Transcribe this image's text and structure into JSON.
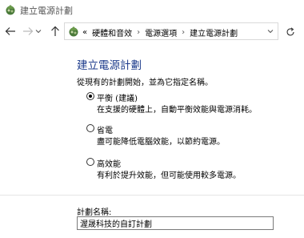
{
  "window": {
    "title": "建立電源計劃"
  },
  "nav": {
    "back_icon": "arrow-left-icon",
    "forward_icon": "arrow-right-icon",
    "up_icon": "arrow-up-icon",
    "breadcrumb_lead": "«",
    "breadcrumbs": [
      "硬體和音效",
      "電源選項",
      "建立電源計劃"
    ],
    "dropdown_icon": "chevron-down-icon",
    "refresh_icon": "refresh-icon"
  },
  "main": {
    "heading": "建立電源計劃",
    "intro": "從現有的計劃開始，並為它指定名稱。",
    "options": [
      {
        "label": "平衡 (建議)",
        "description": "在支援的硬體上，自動平衡效能與電源消耗。",
        "selected": true
      },
      {
        "label": "省電",
        "description": "盡可能降低電腦效能，以節約電源。",
        "selected": false
      },
      {
        "label": "高效能",
        "description": "有利於提升效能，但可能使用較多電源。",
        "selected": false
      }
    ],
    "plan_name_label": "計劃名稱:",
    "plan_name_value": "渥晟科技的自訂計劃"
  }
}
